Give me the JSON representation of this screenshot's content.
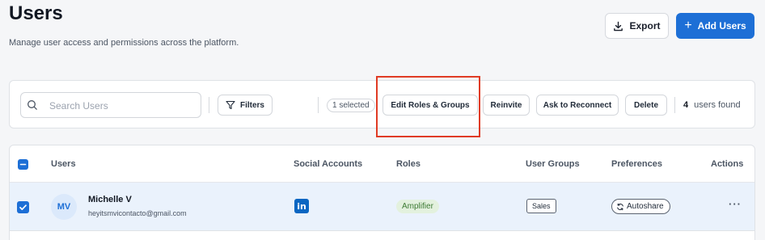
{
  "header": {
    "title": "Users",
    "subtitle": "Manage user access and permissions across the platform.",
    "export_label": "Export",
    "add_label": "Add Users"
  },
  "toolbar": {
    "search_placeholder": "Search Users",
    "filters_label": "Filters",
    "selected_label": "1 selected",
    "edit_roles_label": "Edit Roles & Groups",
    "reinvite_label": "Reinvite",
    "reconnect_label": "Ask to Reconnect",
    "delete_label": "Delete",
    "count": "4",
    "count_label": "users found"
  },
  "table": {
    "columns": {
      "users": "Users",
      "social": "Social Accounts",
      "roles": "Roles",
      "groups": "User Groups",
      "preferences": "Preferences",
      "actions": "Actions"
    },
    "rows": [
      {
        "initials": "MV",
        "name": "Michelle V",
        "email": "heyitsmvicontacto@gmail.com",
        "social": "in",
        "role": "Amplifier",
        "group": "Sales",
        "preference": "Autoshare",
        "actions": "···",
        "selected": true
      }
    ]
  },
  "colors": {
    "accent": "#1d6fd6",
    "highlight": "#e03b24",
    "role_bg": "#e3f1de",
    "linkedin": "#0a66c2"
  }
}
